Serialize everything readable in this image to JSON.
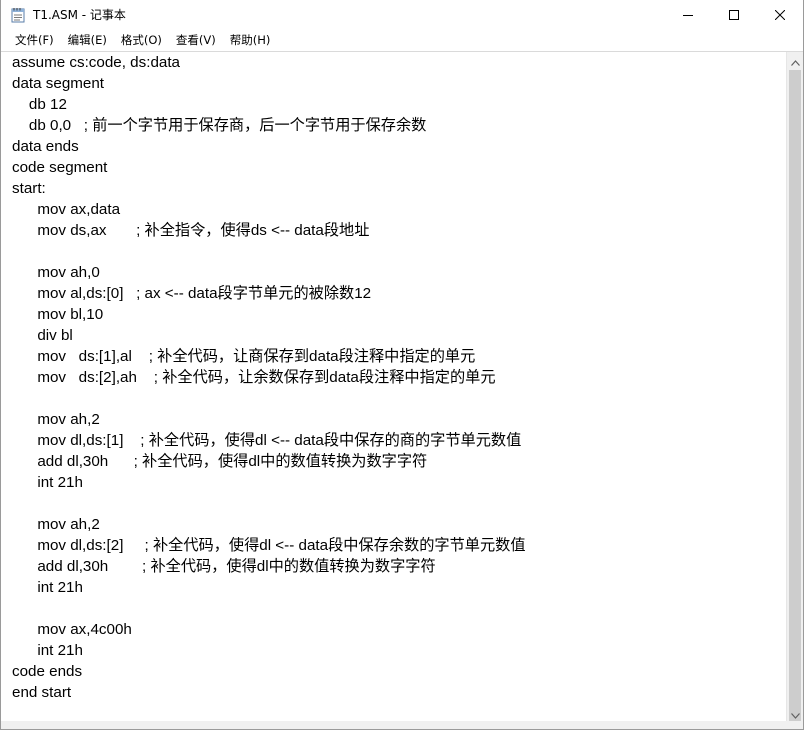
{
  "window": {
    "title": "T1.ASM - 记事本"
  },
  "menu": [
    {
      "label": "文件(F)"
    },
    {
      "label": "编辑(E)"
    },
    {
      "label": "格式(O)"
    },
    {
      "label": "查看(V)"
    },
    {
      "label": "帮助(H)"
    }
  ],
  "editor": {
    "lines": [
      "assume cs:code, ds:data",
      "data segment",
      "    db 12",
      "    db 0,0   ; 前一个字节用于保存商，后一个字节用于保存余数",
      "data ends",
      "code segment",
      "start:",
      "      mov ax,data",
      "      mov ds,ax       ; 补全指令，使得ds <-- data段地址",
      "",
      "      mov ah,0",
      "      mov al,ds:[0]   ; ax <-- data段字节单元的被除数12",
      "      mov bl,10",
      "      div bl",
      "      mov   ds:[1],al    ; 补全代码，让商保存到data段注释中指定的单元",
      "      mov   ds:[2],ah    ; 补全代码，让余数保存到data段注释中指定的单元",
      "",
      "      mov ah,2",
      "      mov dl,ds:[1]    ; 补全代码，使得dl <-- data段中保存的商的字节单元数值",
      "      add dl,30h      ; 补全代码，使得dl中的数值转换为数字字符",
      "      int 21h",
      "",
      "      mov ah,2",
      "      mov dl,ds:[2]     ; 补全代码，使得dl <-- data段中保存余数的字节单元数值",
      "      add dl,30h        ; 补全代码，使得dl中的数值转换为数字字符",
      "      int 21h",
      "",
      "      mov ax,4c00h",
      "      int 21h",
      "code ends",
      "end start"
    ]
  },
  "icons": {
    "app": "notepad-icon",
    "minimize": "minimize-icon",
    "maximize": "maximize-icon",
    "close": "close-icon",
    "scroll_up": "chevron-up-icon",
    "scroll_down": "chevron-down-icon"
  }
}
